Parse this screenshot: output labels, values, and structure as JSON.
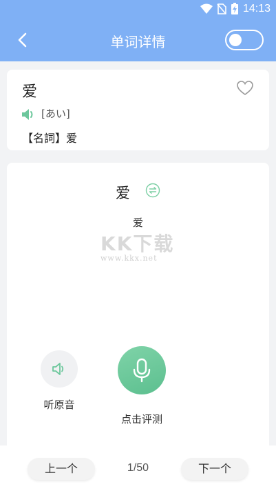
{
  "status": {
    "time": "14:13"
  },
  "header": {
    "title": "单词详情",
    "toggle_on": false
  },
  "word_card": {
    "word": "爱",
    "reading": "[あい]",
    "definition": "【名詞】爱",
    "favorited": false
  },
  "practice": {
    "word": "爱",
    "meaning": "爱",
    "listen_label": "听原音",
    "record_label": "点击评测"
  },
  "watermark": {
    "main": "KK下载",
    "url": "www.kkx.net"
  },
  "footer": {
    "prev_label": "上一个",
    "counter": "1/50",
    "next_label": "下一个"
  },
  "colors": {
    "header": "#7fb0f5",
    "accent_green": "#6cc79c"
  }
}
